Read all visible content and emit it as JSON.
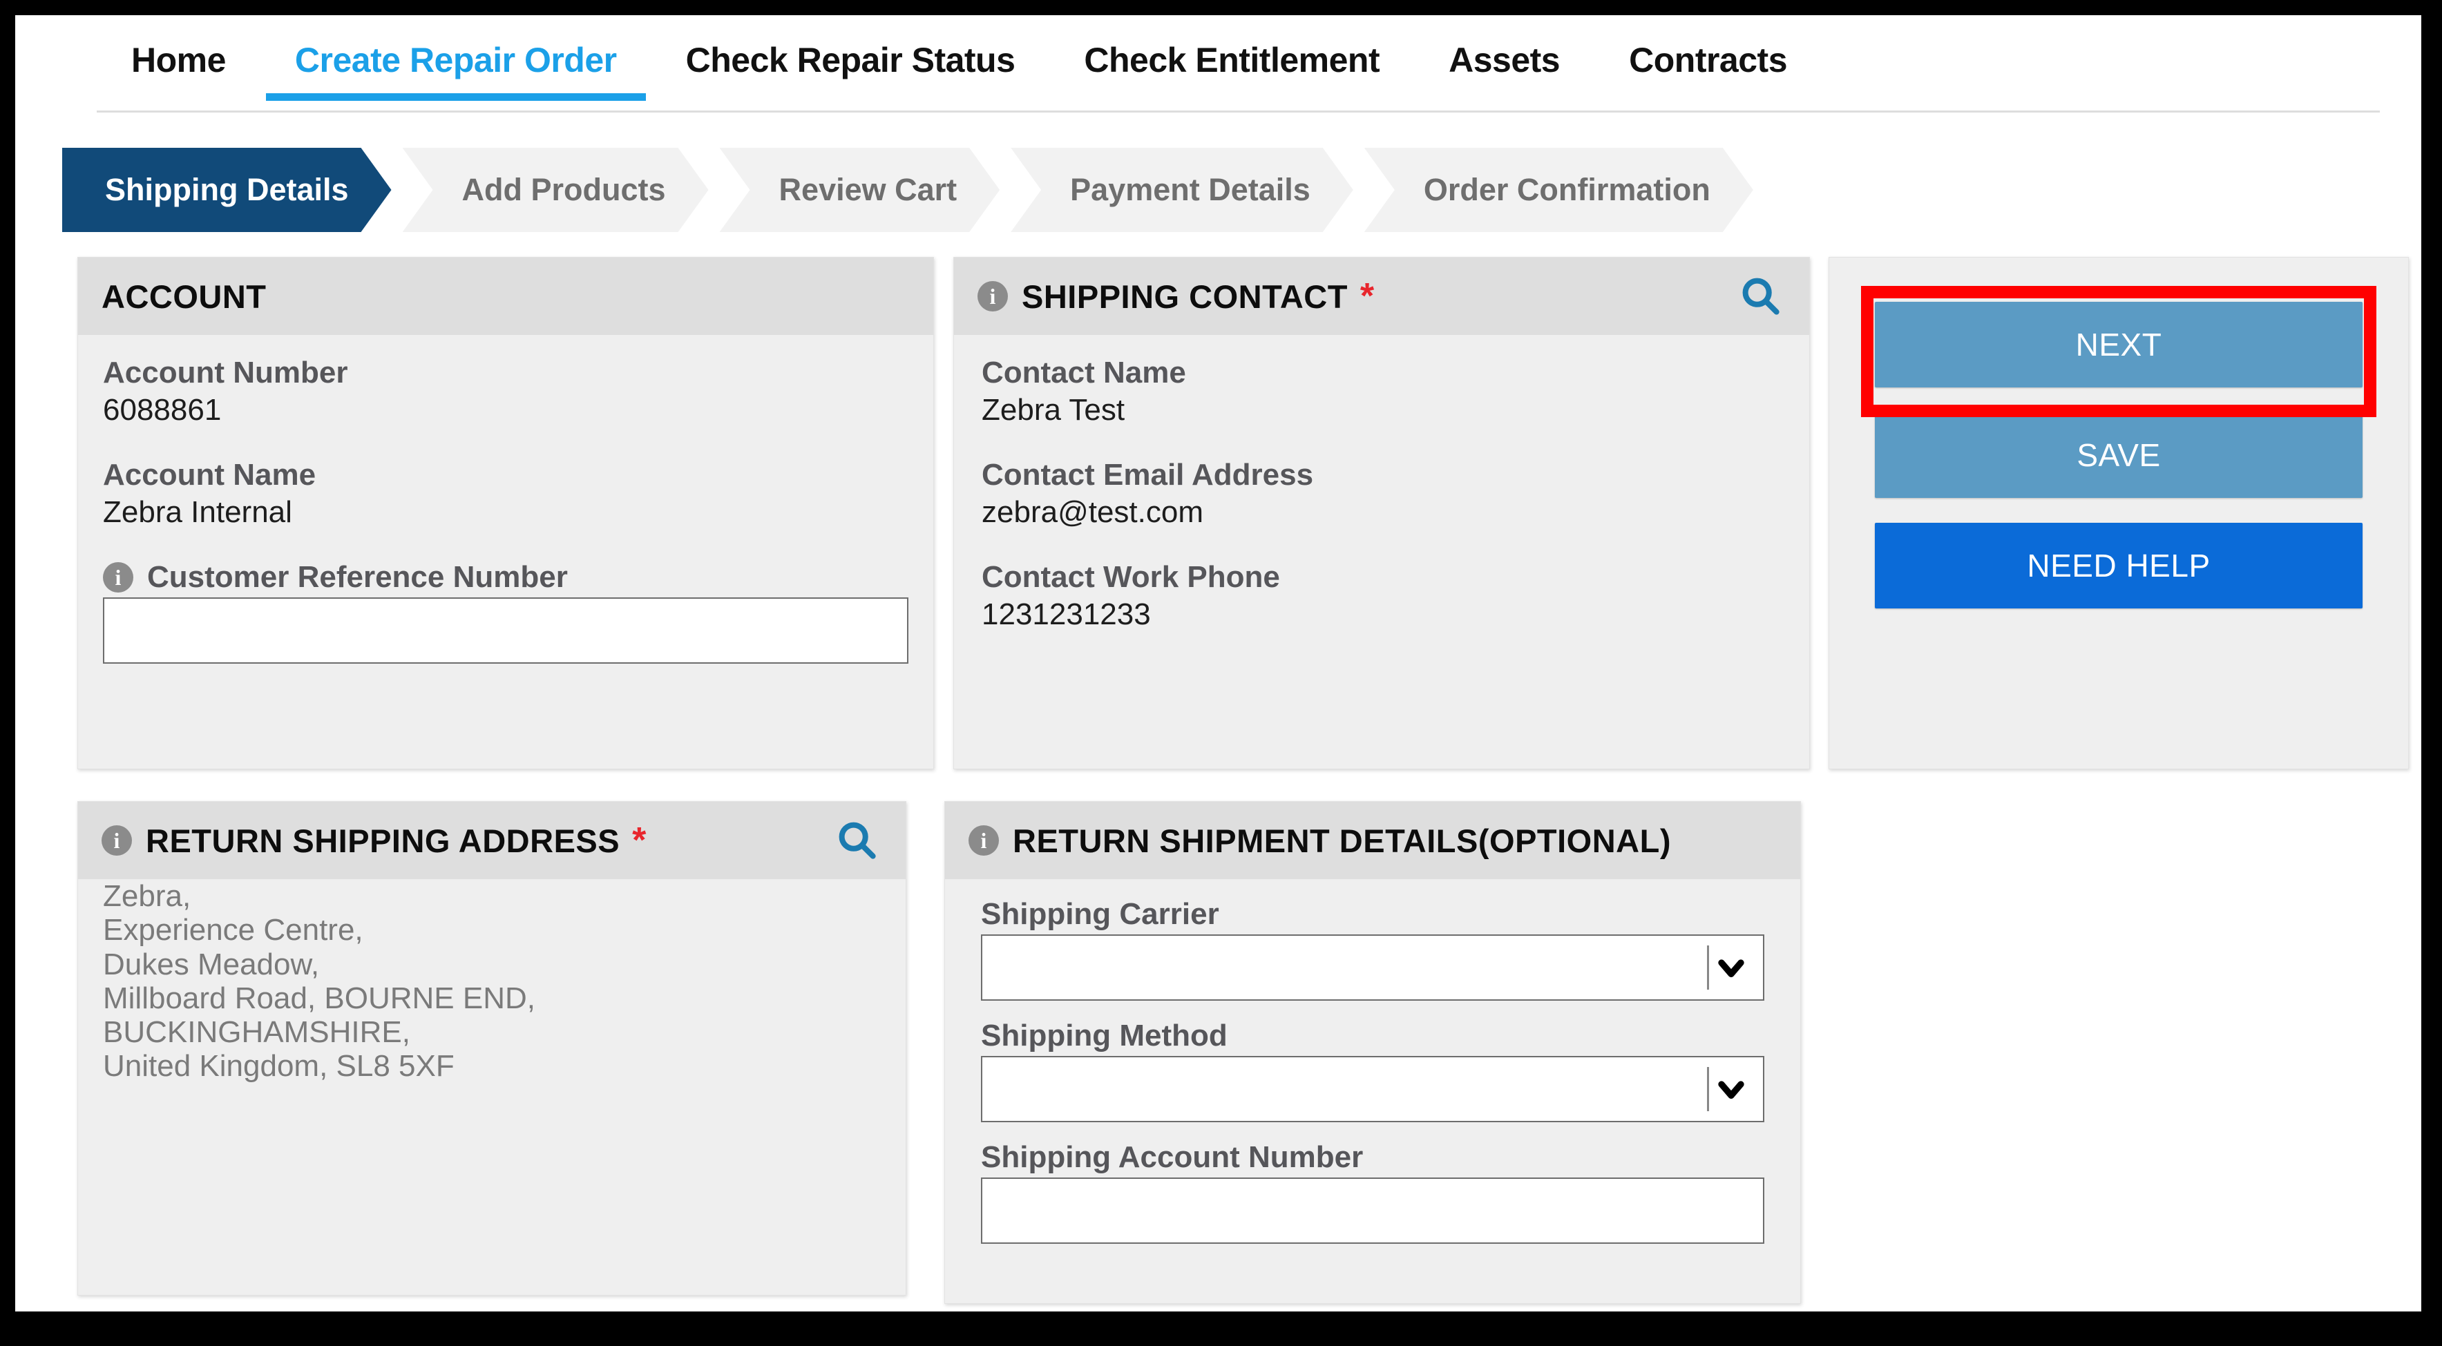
{
  "nav": {
    "items": [
      {
        "label": "Home",
        "active": false
      },
      {
        "label": "Create Repair Order",
        "active": true
      },
      {
        "label": "Check Repair Status",
        "active": false
      },
      {
        "label": "Check Entitlement",
        "active": false
      },
      {
        "label": "Assets",
        "active": false
      },
      {
        "label": "Contracts",
        "active": false
      }
    ]
  },
  "steps": [
    {
      "label": "Shipping Details",
      "active": true
    },
    {
      "label": "Add Products",
      "active": false
    },
    {
      "label": "Review Cart",
      "active": false
    },
    {
      "label": "Payment Details",
      "active": false
    },
    {
      "label": "Order Confirmation",
      "active": false
    }
  ],
  "account_card": {
    "title": "ACCOUNT",
    "account_number_label": "Account Number",
    "account_number_value": "6088861",
    "account_name_label": "Account Name",
    "account_name_value": "Zebra Internal",
    "customer_reference_label": "Customer Reference Number",
    "customer_reference_value": "",
    "customer_reference_placeholder": ""
  },
  "shipping_contact_card": {
    "title": "SHIPPING CONTACT",
    "required_marker": "*",
    "contact_name_label": "Contact Name",
    "contact_name_value": "Zebra Test",
    "contact_email_label": "Contact Email Address",
    "contact_email_value": "zebra@test.com",
    "contact_phone_label": "Contact Work Phone",
    "contact_phone_value": "1231231233"
  },
  "return_address_card": {
    "title": "RETURN SHIPPING ADDRESS",
    "required_marker": "*",
    "address_lines": [
      "Zebra,",
      "Experience Centre,",
      "Dukes Meadow,",
      "Millboard Road, BOURNE END,",
      "BUCKINGHAMSHIRE,",
      "United Kingdom, SL8 5XF"
    ]
  },
  "return_shipment_card": {
    "title": "RETURN SHIPMENT DETAILS(OPTIONAL)",
    "shipping_carrier_label": "Shipping Carrier",
    "shipping_carrier_value": "",
    "shipping_method_label": "Shipping Method",
    "shipping_method_value": "",
    "shipping_account_label": "Shipping Account Number",
    "shipping_account_value": "",
    "shipping_account_placeholder": ""
  },
  "actions": {
    "next_label": "NEXT",
    "save_label": "SAVE",
    "need_help_label": "NEED HELP"
  },
  "icons": {
    "info": "info-icon",
    "search": "search-icon",
    "chevron_down": "chevron-down-icon"
  },
  "colors": {
    "accent_blue": "#1ba0e8",
    "step_active": "#114a79",
    "button_secondary": "#5b9bc4",
    "button_primary": "#0b6bd8",
    "required_red": "#e8262d",
    "highlight_red": "#ff0000",
    "search_icon_blue": "#1b7bb0"
  }
}
